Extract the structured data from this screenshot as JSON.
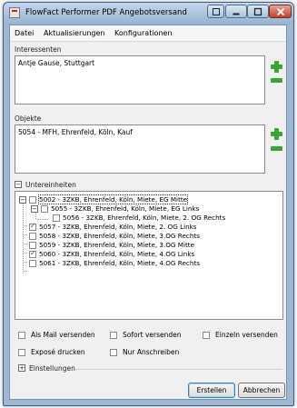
{
  "window": {
    "title": "FlowFact Performer PDF Angebotsversand"
  },
  "menu": [
    "Datei",
    "Aktualisierungen",
    "Konfigurationen"
  ],
  "interessenten": {
    "label": "Interessenten",
    "items": [
      "Antje Gause, Stuttgart"
    ]
  },
  "objekte": {
    "label": "Objekte",
    "items": [
      "5054 - MFH, Ehrenfeld, Köln, Kauf"
    ]
  },
  "untereinheiten": {
    "label": "Untereinheiten",
    "expander": "−",
    "tree": [
      {
        "text": "5002 - 3ZKB, Ehrenfeld, Köln, Miete, EG Mitte",
        "checked": false,
        "level": 0,
        "expander": "−"
      },
      {
        "text": "5055 - 3ZKB, Ehrenfeld, Köln, Miete, EG Links",
        "checked": false,
        "level": 1,
        "expander": "−"
      },
      {
        "text": "5056 - 3ZKB, Ehrenfeld, Köln, Miete, 2. OG Rechts",
        "checked": false,
        "level": 2,
        "expander": ""
      },
      {
        "text": "5057 - 3ZKB, Ehrenfeld, Köln, Miete, 2. OG Links",
        "checked": true,
        "level": 0,
        "expander": ""
      },
      {
        "text": "5058 - 3ZKB, Ehrenfeld, Köln, Miete, 3.OG Rechts",
        "checked": false,
        "level": 0,
        "expander": ""
      },
      {
        "text": "5059 - 3ZKB, Ehrenfeld, Köln, Miete, 3.OG Mitte",
        "checked": false,
        "level": 0,
        "expander": ""
      },
      {
        "text": "5060 - 3ZKB, Ehrenfeld, Köln, Miete, 4.OG Links",
        "checked": true,
        "level": 0,
        "expander": ""
      },
      {
        "text": "5061 - 3ZKB, Ehrenfeld, Köln, Miete, 4.OG Rechts",
        "checked": false,
        "level": 0,
        "expander": ""
      }
    ]
  },
  "options": {
    "als_mail": "Als Mail versenden",
    "sofort": "Sofort versenden",
    "einzeln": "Einzeln versenden",
    "expose": "Exposé drucken",
    "nur_anschreiben": "Nur Anschreiben"
  },
  "einstellungen": {
    "label": "Einstellungen",
    "expander": "+"
  },
  "buttons": {
    "erstellen": "Erstellen",
    "abbrechen": "Abbrechen"
  }
}
